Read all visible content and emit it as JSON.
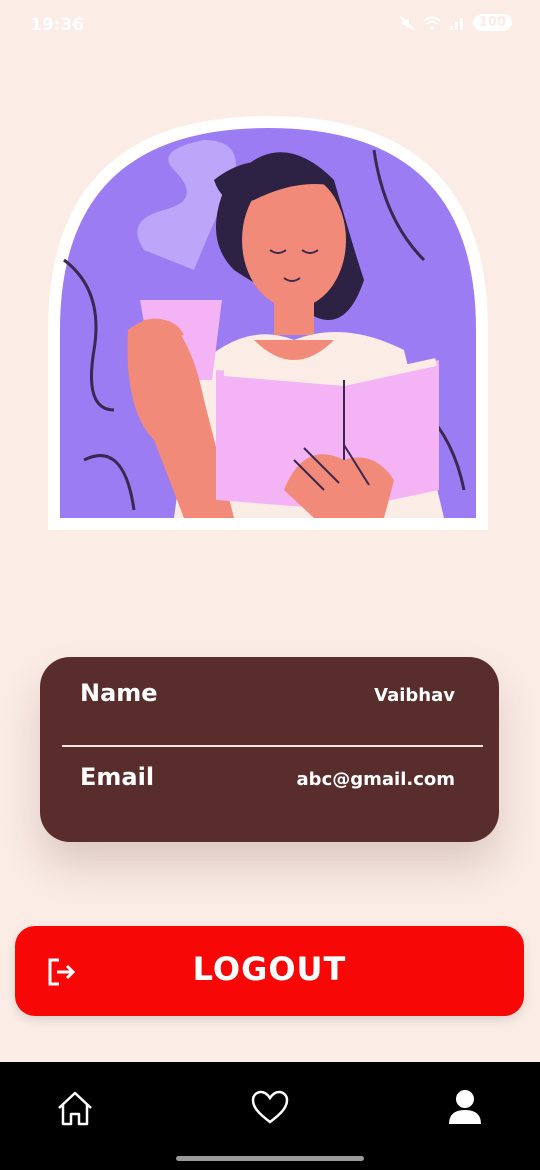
{
  "status_bar": {
    "time": "19:36",
    "battery": "100"
  },
  "profile": {
    "name_label": "Name",
    "name_value": "Vaibhav",
    "email_label": "Email",
    "email_value": "abc@gmail.com"
  },
  "logout": {
    "label": "LOGOUT"
  },
  "nav": {
    "items": [
      "home-icon",
      "heart-icon",
      "user-icon"
    ]
  },
  "colors": {
    "card": "#5a2d2d",
    "logout": "#f80707",
    "background": "#fbece6",
    "illustration_bg": "#9c7cf3"
  }
}
